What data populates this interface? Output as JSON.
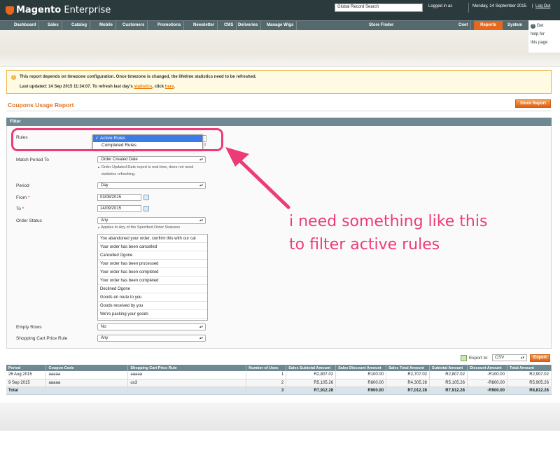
{
  "header": {
    "logo_bold": "Magento",
    "logo_rest": " Enterprise",
    "search_value": "Global Record Search",
    "logged_in": "Logged in as",
    "date": "Monday, 14 September 2015",
    "separator": "|",
    "logout": "Log Out"
  },
  "nav": {
    "items": [
      "Dashboard",
      "Sales",
      "Catalog",
      "Mobile",
      "Customers",
      "Promotions",
      "Newsletter",
      "CMS",
      "Deliveries",
      "Manage Wigs",
      "Store Finder",
      "Cnet",
      "Reports",
      "System"
    ],
    "help_line1": "Get",
    "help_line2": "help for",
    "help_line3": "this page",
    "help_icon": "?"
  },
  "notice": {
    "icon": "!",
    "line1": "This report depends on timezone configuration. Once timezone is changed, the lifetime statistics need to be refreshed.",
    "line2_prefix": "Last updated: 14 Sep 2015 11:34:07. To refresh last day's ",
    "line2_link1": "statistics",
    "line2_middle": ", click ",
    "line2_link2": "here",
    "line2_suffix": "."
  },
  "page": {
    "title": "Coupons Usage Report",
    "show_report": "Show Report"
  },
  "filter": {
    "title": "Filter",
    "rules_label": "Rules",
    "rules_options": [
      "✓ Active Rules",
      "Completed Rules"
    ],
    "rules_faded_text": "statistics refreshing",
    "rules_faded_tail": "d",
    "match_period_label": "Match Period To",
    "match_period_value": "Order Created Date",
    "match_period_hint1": "Order Updated Date report is real-time, does not need",
    "match_period_hint2": "statistics refreshing.",
    "period_label": "Period",
    "period_value": "Day",
    "from_label": "From",
    "from_value": "03/08/2015",
    "to_label": "To",
    "to_value": "14/09/2015",
    "required_mark": "*",
    "order_status_label": "Order Status",
    "order_status_value": "Any",
    "order_status_hint": "Applies to Any of the Specified Order Statuses",
    "statuses": [
      "You abandoned your order, confirm this with our cal",
      "Your order has been cancelled",
      "Cancelled Ogone",
      "Your order has been processed",
      "Your order has been completed",
      "Your order has been completed",
      "Declined Ogone",
      "Goods en route to you",
      "Goods received by you",
      "We're packing your goods"
    ],
    "empty_rows_label": "Empty Rows",
    "empty_rows_value": "No",
    "cart_rule_label": "Shopping Cart Price Rule",
    "cart_rule_value": "Any"
  },
  "annotation": {
    "line1": "i need something like this",
    "line2": "to filter active rules",
    "color": "#ee3b7a"
  },
  "export": {
    "label": "Export to:",
    "format": "CSV",
    "button": "Export"
  },
  "grid": {
    "columns": [
      "Period",
      "Coupon Code",
      "Shopping Cart Price Rule",
      "Number of Uses",
      "Sales Subtotal Amount",
      "Sales Discount Amount",
      "Sales Total Amount",
      "Subtotal Amount",
      "Discount Amount",
      "Total Amount"
    ],
    "rows": [
      [
        "26 Aug 2015",
        "aaaaa",
        "aaaaa",
        "1",
        "R2,807.02",
        "R100.00",
        "R2,707.02",
        "R2,807.02",
        "-R100.00",
        "R2,907.02"
      ],
      [
        "9 Sep 2015",
        "aaaaa",
        "us3",
        "2",
        "R5,105.26",
        "R800.00",
        "R4,305.26",
        "R5,105.26",
        "-R800.00",
        "R5,905.26"
      ]
    ],
    "total": [
      "Total",
      "",
      "",
      "3",
      "R7,912.28",
      "R900.00",
      "R7,012.28",
      "R7,912.28",
      "-R900.00",
      "R8,812.28"
    ]
  },
  "colors": {
    "accent": "#e6681f",
    "header_bg": "#2b3a3d",
    "nav_bg": "#55686b",
    "grid_header": "#6f8992",
    "highlight": "#ec3b78"
  }
}
